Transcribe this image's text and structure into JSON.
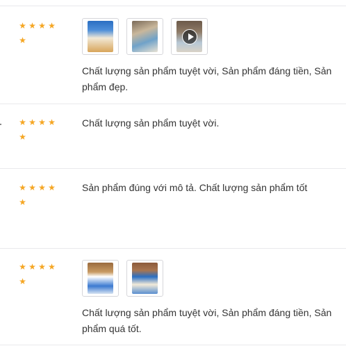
{
  "reviews": [
    {
      "rating": 5,
      "images": [
        {
          "icon": "product-photo-icon"
        },
        {
          "icon": "product-photo-icon"
        },
        {
          "icon": "video-thumbnail-icon",
          "video": true
        }
      ],
      "text": "Chất lượng sản phẩm tuyệt vời, Sản phẩm đáng tiền, Sản phẩm đẹp."
    },
    {
      "rating": 5,
      "images": [],
      "text": "Chất lượng sản phẩm tuyệt vời."
    },
    {
      "rating": 5,
      "images": [],
      "text": "Sản phẩm đúng với mô tả. Chất lượng sản phẩm tốt"
    },
    {
      "rating": 5,
      "images": [
        {
          "icon": "product-photo-icon"
        },
        {
          "icon": "product-photo-icon"
        }
      ],
      "text": "Chất lượng sản phẩm tuyệt vời, Sản phẩm đáng tiền, Sản phẩm quá tốt."
    }
  ],
  "colors": {
    "star": "#f5a623",
    "divider": "#e9e9ec",
    "text": "#333333"
  }
}
